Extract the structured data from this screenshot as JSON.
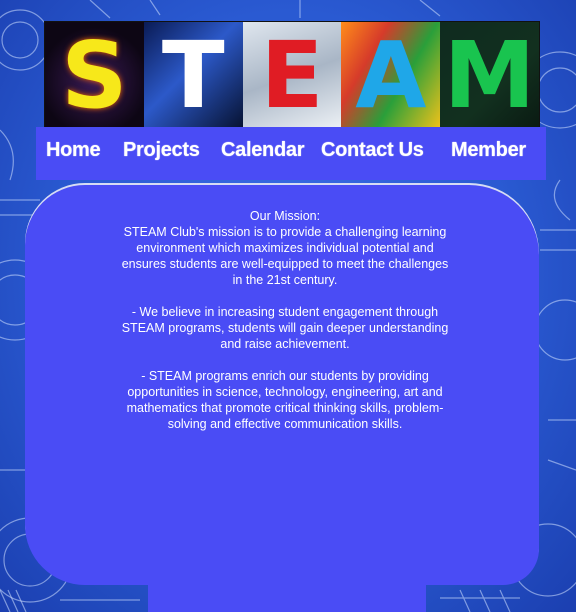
{
  "banner": {
    "letters": [
      "S",
      "T",
      "E",
      "A",
      "M"
    ]
  },
  "nav": {
    "items": [
      "Home",
      "Projects",
      "Calendar",
      "Contact Us",
      "Member"
    ]
  },
  "mission": {
    "title": "Our Mission:",
    "paragraphs": [
      "STEAM Club's mission is to provide a challenging learning environment which maximizes individual potential and ensures students are well-equipped to meet the challenges in the 21st century.",
      "- We believe in increasing student engagement through STEAM programs, students will gain deeper understanding and raise achievement.",
      "- STEAM programs enrich our students by providing opportunities in science, technology, engineering, art and mathematics that promote critical thinking skills, problem-solving and effective communication skills."
    ]
  },
  "colors": {
    "panel": "#4a4cf5",
    "background": "#2a5fd8",
    "text": "#ffffff"
  }
}
